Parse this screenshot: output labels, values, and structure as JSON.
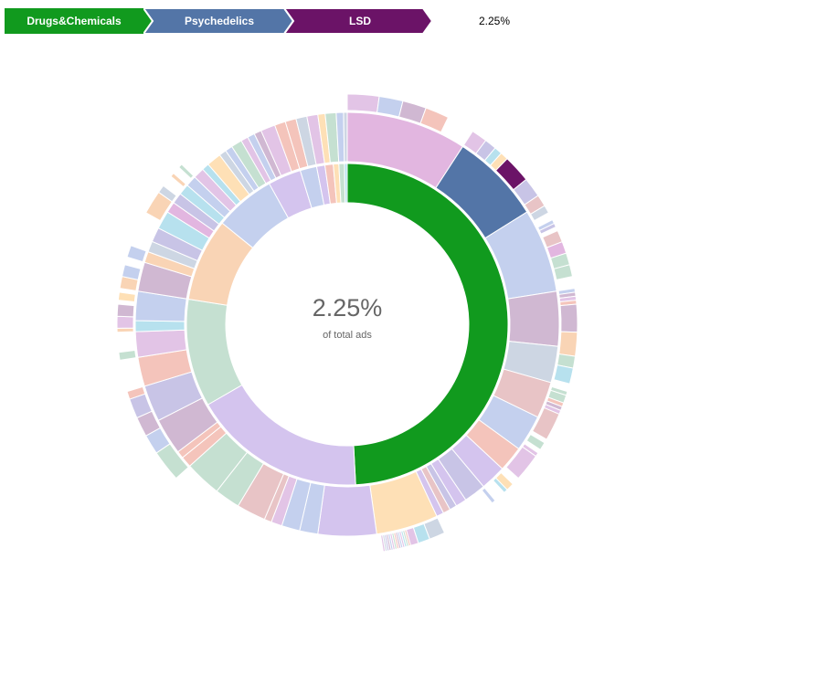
{
  "breadcrumb": {
    "items": [
      {
        "label": "Drugs&Chemicals",
        "color": "#119a1e"
      },
      {
        "label": "Psychedelics",
        "color": "#5375a7"
      },
      {
        "label": "LSD",
        "color": "#6b1367"
      }
    ],
    "end_label": "2.25%"
  },
  "center": {
    "percentage": "2.25%",
    "caption": "of total ads"
  },
  "chart_data": {
    "type": "sunburst",
    "highlight_path": [
      "Drugs&Chemicals",
      "Psychedelics",
      "LSD"
    ],
    "highlight_value_percent": 2.25,
    "rings": [
      [
        {
          "start": 0,
          "end": 177,
          "color": "#119a1e"
        },
        {
          "start": 177,
          "end": 240,
          "color": "#d4c4ee"
        },
        {
          "start": 240,
          "end": 279,
          "color": "#c5e0d1"
        },
        {
          "start": 279,
          "end": 309,
          "color": "#f9d4b5"
        },
        {
          "start": 309,
          "end": 331,
          "color": "#c4d0ee"
        },
        {
          "start": 331,
          "end": 343,
          "color": "#d4c4ee"
        },
        {
          "start": 343,
          "end": 349,
          "color": "#c4d0ee"
        },
        {
          "start": 349,
          "end": 352,
          "color": "#d4c4ee"
        },
        {
          "start": 352,
          "end": 355,
          "color": "#f4c4bb"
        },
        {
          "start": 355,
          "end": 357,
          "color": "#fee0b6"
        },
        {
          "start": 357,
          "end": 359,
          "color": "#c5e0d1"
        },
        {
          "start": 359,
          "end": 360,
          "color": "#b7e1ee"
        }
      ],
      [
        {
          "start": 0,
          "end": 33,
          "color": "#e2b6e0"
        },
        {
          "start": 33,
          "end": 58,
          "color": "#5375a7"
        },
        {
          "start": 58,
          "end": 81,
          "color": "#c4d0ee"
        },
        {
          "start": 81,
          "end": 96,
          "color": "#d0b8d2"
        },
        {
          "start": 96,
          "end": 106,
          "color": "#cdd6e3"
        },
        {
          "start": 106,
          "end": 116,
          "color": "#e8c4c6"
        },
        {
          "start": 116,
          "end": 126,
          "color": "#c4d0ee"
        },
        {
          "start": 126,
          "end": 133,
          "color": "#f4c4bb"
        },
        {
          "start": 133,
          "end": 140,
          "color": "#d4c4ee"
        },
        {
          "start": 140,
          "end": 146,
          "color": "#c8c4e6"
        },
        {
          "start": 146,
          "end": 149,
          "color": "#d4c4ee"
        },
        {
          "start": 149,
          "end": 151,
          "color": "#c8c4e6"
        },
        {
          "start": 151,
          "end": 153,
          "color": "#e8c4c6"
        },
        {
          "start": 153,
          "end": 155,
          "color": "#d4c4ee"
        },
        {
          "start": 155,
          "end": 172,
          "color": "#fee0b6"
        },
        {
          "start": 172,
          "end": 188,
          "color": "#d4c4ee"
        },
        {
          "start": 188,
          "end": 193,
          "color": "#c4d0ee"
        },
        {
          "start": 193,
          "end": 198,
          "color": "#c4d0ee"
        },
        {
          "start": 198,
          "end": 201,
          "color": "#e2c4e6"
        },
        {
          "start": 201,
          "end": 203,
          "color": "#e8c4c6"
        },
        {
          "start": 203,
          "end": 211,
          "color": "#e8c4c6"
        },
        {
          "start": 211,
          "end": 218,
          "color": "#c5e0d1"
        },
        {
          "start": 218,
          "end": 228,
          "color": "#c5e0d1"
        },
        {
          "start": 228,
          "end": 231,
          "color": "#f4c4bb"
        },
        {
          "start": 231,
          "end": 233,
          "color": "#f4c4bb"
        },
        {
          "start": 233,
          "end": 243,
          "color": "#d0b8d2"
        },
        {
          "start": 243,
          "end": 253,
          "color": "#c8c4e6"
        },
        {
          "start": 253,
          "end": 261,
          "color": "#f4c4bb"
        },
        {
          "start": 261,
          "end": 268,
          "color": "#e2c4e6"
        },
        {
          "start": 268,
          "end": 271,
          "color": "#b7e1ee"
        },
        {
          "start": 271,
          "end": 279,
          "color": "#c4d0ee"
        },
        {
          "start": 279,
          "end": 287,
          "color": "#d0b8d2"
        },
        {
          "start": 287,
          "end": 290,
          "color": "#f9d4b5"
        },
        {
          "start": 290,
          "end": 293,
          "color": "#cdd6e3"
        },
        {
          "start": 293,
          "end": 297,
          "color": "#c8c4e6"
        },
        {
          "start": 297,
          "end": 302,
          "color": "#b7e1ee"
        },
        {
          "start": 302,
          "end": 305,
          "color": "#e2b6e0"
        },
        {
          "start": 305,
          "end": 308,
          "color": "#c8c4e6"
        },
        {
          "start": 308,
          "end": 311,
          "color": "#b7e1ee"
        },
        {
          "start": 311,
          "end": 314,
          "color": "#c4d0ee"
        },
        {
          "start": 314,
          "end": 317,
          "color": "#e2c4e6"
        },
        {
          "start": 317,
          "end": 319,
          "color": "#b7e1ee"
        },
        {
          "start": 319,
          "end": 323,
          "color": "#fee0b6"
        },
        {
          "start": 323,
          "end": 325,
          "color": "#cdd6e3"
        },
        {
          "start": 325,
          "end": 327,
          "color": "#c4d0ee"
        },
        {
          "start": 327,
          "end": 330,
          "color": "#c5e0d1"
        },
        {
          "start": 330,
          "end": 332,
          "color": "#e2c4e6"
        },
        {
          "start": 332,
          "end": 334,
          "color": "#c4d0ee"
        },
        {
          "start": 334,
          "end": 336,
          "color": "#d0b8d2"
        },
        {
          "start": 336,
          "end": 340,
          "color": "#e2c4e6"
        },
        {
          "start": 340,
          "end": 343,
          "color": "#f4c4bb"
        },
        {
          "start": 343,
          "end": 346,
          "color": "#f4c4bb"
        },
        {
          "start": 346,
          "end": 349,
          "color": "#cdd6e3"
        },
        {
          "start": 349,
          "end": 352,
          "color": "#e2c4e6"
        },
        {
          "start": 352,
          "end": 354,
          "color": "#fee0b6"
        },
        {
          "start": 354,
          "end": 357,
          "color": "#c5e0d1"
        },
        {
          "start": 357,
          "end": 359,
          "color": "#c4d0ee"
        },
        {
          "start": 359,
          "end": 360,
          "color": "#cdd6e3"
        }
      ],
      [
        {
          "start": 0,
          "end": 8,
          "color": "#e2c4e6"
        },
        {
          "start": 8,
          "end": 14,
          "color": "#c4d0ee"
        },
        {
          "start": 14,
          "end": 20,
          "color": "#d0b8d2"
        },
        {
          "start": 20,
          "end": 26,
          "color": "#f4c4bb"
        },
        {
          "start": 33,
          "end": 37,
          "color": "#e2c4e6"
        },
        {
          "start": 37,
          "end": 40,
          "color": "#c8c4e6"
        },
        {
          "start": 40,
          "end": 42,
          "color": "#b7e1ee"
        },
        {
          "start": 42,
          "end": 44,
          "color": "#fee0b6"
        },
        {
          "start": 44,
          "end": 51,
          "color": "#6b1367"
        },
        {
          "start": 51,
          "end": 56,
          "color": "#c8c4e6"
        },
        {
          "start": 56,
          "end": 59,
          "color": "#e8c4c6"
        },
        {
          "start": 59,
          "end": 61,
          "color": "#cdd6e3"
        },
        {
          "start": 63,
          "end": 64,
          "color": "#c4d0ee"
        },
        {
          "start": 64,
          "end": 65,
          "color": "#c8c4e6"
        },
        {
          "start": 66,
          "end": 69,
          "color": "#e8c4c6"
        },
        {
          "start": 69,
          "end": 72,
          "color": "#e2b6e0"
        },
        {
          "start": 72,
          "end": 75,
          "color": "#c5e0d1"
        },
        {
          "start": 75,
          "end": 78,
          "color": "#c5e0d1"
        },
        {
          "start": 81,
          "end": 82,
          "color": "#c4d0ee"
        },
        {
          "start": 82,
          "end": 83,
          "color": "#d0b8d2"
        },
        {
          "start": 83,
          "end": 84,
          "color": "#e2c4e6"
        },
        {
          "start": 84,
          "end": 85,
          "color": "#f4c4bb"
        },
        {
          "start": 85,
          "end": 92,
          "color": "#d0b8d2"
        },
        {
          "start": 92,
          "end": 98,
          "color": "#f9d4b5"
        },
        {
          "start": 98,
          "end": 101,
          "color": "#c5e0d1"
        },
        {
          "start": 101,
          "end": 105,
          "color": "#b7e1ee"
        },
        {
          "start": 107,
          "end": 108,
          "color": "#c5e0d1"
        },
        {
          "start": 108,
          "end": 110,
          "color": "#c5e0d1"
        },
        {
          "start": 110,
          "end": 111,
          "color": "#f4c4bb"
        },
        {
          "start": 111,
          "end": 112,
          "color": "#d0b8d2"
        },
        {
          "start": 112,
          "end": 113,
          "color": "#e2c4e6"
        },
        {
          "start": 113,
          "end": 120,
          "color": "#e8c4c6"
        },
        {
          "start": 121,
          "end": 123,
          "color": "#c5e0d1"
        },
        {
          "start": 124,
          "end": 125,
          "color": "#e2c4e6"
        },
        {
          "start": 125,
          "end": 132,
          "color": "#e2c4e6"
        },
        {
          "start": 134,
          "end": 136,
          "color": "#fee0b6"
        },
        {
          "start": 136,
          "end": 137,
          "color": "#b7e1ee"
        },
        {
          "start": 140,
          "end": 141,
          "color": "#c4d0ee"
        },
        {
          "start": 155,
          "end": 159,
          "color": "#cdd6e3"
        },
        {
          "start": 159,
          "end": 162,
          "color": "#b7e1ee"
        },
        {
          "start": 162,
          "end": 164,
          "color": "#e2c4e6"
        },
        {
          "start": 164,
          "end": 164.5,
          "color": "#f4c4bb"
        },
        {
          "start": 164.5,
          "end": 165,
          "color": "#c5e0d1"
        },
        {
          "start": 165,
          "end": 165.5,
          "color": "#b7e1ee"
        },
        {
          "start": 165.5,
          "end": 166,
          "color": "#e2c4e6"
        },
        {
          "start": 166,
          "end": 166.5,
          "color": "#c4d0ee"
        },
        {
          "start": 166.5,
          "end": 167,
          "color": "#d0b8d2"
        },
        {
          "start": 167,
          "end": 167.5,
          "color": "#f4c4bb"
        },
        {
          "start": 167.5,
          "end": 168,
          "color": "#c5e0d1"
        },
        {
          "start": 168,
          "end": 168.5,
          "color": "#e2c4e6"
        },
        {
          "start": 168.5,
          "end": 169,
          "color": "#c4d0ee"
        },
        {
          "start": 169,
          "end": 169.5,
          "color": "#d0b8d2"
        },
        {
          "start": 169.5,
          "end": 170,
          "color": "#c8c4e6"
        },
        {
          "start": 170,
          "end": 170.5,
          "color": "#cdd6e3"
        },
        {
          "start": 170.5,
          "end": 171,
          "color": "#e2c4e6"
        },
        {
          "start": 228,
          "end": 236,
          "color": "#c5e0d1"
        },
        {
          "start": 236,
          "end": 241,
          "color": "#c4d0ee"
        },
        {
          "start": 241,
          "end": 246,
          "color": "#d0b8d2"
        },
        {
          "start": 246,
          "end": 251,
          "color": "#c8c4e6"
        },
        {
          "start": 251,
          "end": 253,
          "color": "#f4c4bb"
        },
        {
          "start": 261,
          "end": 263,
          "color": "#c5e0d1"
        },
        {
          "start": 268,
          "end": 269,
          "color": "#f9d4b5"
        },
        {
          "start": 269,
          "end": 272,
          "color": "#e2c4e6"
        },
        {
          "start": 272,
          "end": 275,
          "color": "#d0b8d2"
        },
        {
          "start": 276,
          "end": 278,
          "color": "#fee0b6"
        },
        {
          "start": 279,
          "end": 282,
          "color": "#f9d4b5"
        },
        {
          "start": 282,
          "end": 285,
          "color": "#c4d0ee"
        },
        {
          "start": 287,
          "end": 290,
          "color": "#c4d0ee"
        },
        {
          "start": 299,
          "end": 305,
          "color": "#f9d4b5"
        },
        {
          "start": 305,
          "end": 307,
          "color": "#cdd6e3"
        },
        {
          "start": 310,
          "end": 311,
          "color": "#f9d4b5"
        },
        {
          "start": 313,
          "end": 314,
          "color": "#c5e0d1"
        }
      ]
    ]
  }
}
